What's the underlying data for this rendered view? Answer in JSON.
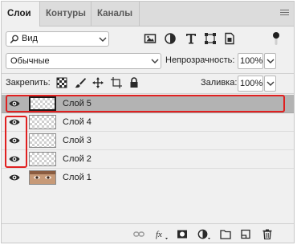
{
  "tabs": [
    {
      "label": "Слои",
      "active": true
    },
    {
      "label": "Контуры",
      "active": false
    },
    {
      "label": "Каналы",
      "active": false
    }
  ],
  "filter": {
    "kind_label": "Вид"
  },
  "blend": {
    "mode": "Обычные"
  },
  "opacity": {
    "label": "Непрозрачность:",
    "value": "100%"
  },
  "lock": {
    "label": "Закрепить:"
  },
  "fill": {
    "label": "Заливка:",
    "value": "100%"
  },
  "layers": [
    {
      "name": "Слой 5",
      "selected": true,
      "visible": true,
      "thumb": "transparent"
    },
    {
      "name": "Слой 4",
      "selected": false,
      "visible": true,
      "thumb": "transparent"
    },
    {
      "name": "Слой 3",
      "selected": false,
      "visible": true,
      "thumb": "transparent"
    },
    {
      "name": "Слой 2",
      "selected": false,
      "visible": true,
      "thumb": "transparent"
    },
    {
      "name": "Слой 1",
      "selected": false,
      "visible": true,
      "thumb": "photo"
    }
  ],
  "bottom_icons": [
    "link-icon",
    "fx-icon",
    "mask-icon",
    "adjustment-icon",
    "folder-icon",
    "new-layer-icon",
    "trash-icon"
  ],
  "colors": {
    "highlight": "#e02020",
    "selected_row": "#b3b3b3"
  }
}
